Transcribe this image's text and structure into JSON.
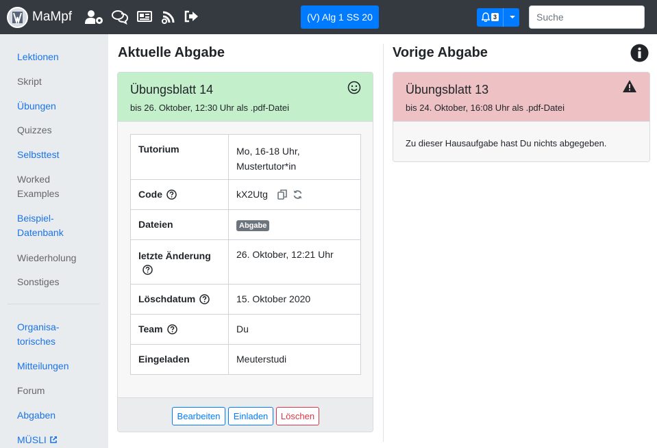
{
  "app": {
    "brand": "MaMpf",
    "lecture_button": "(V) Alg 1 SS 20",
    "notification_count": "3",
    "search_placeholder": "Suche",
    "nav_icons": [
      "user-cog-icon",
      "comments-icon",
      "newspaper-icon",
      "blog-icon",
      "sign-out-icon"
    ]
  },
  "sidebar": {
    "items": [
      {
        "label": "Lektionen",
        "link": true
      },
      {
        "label": "Skript",
        "link": false
      },
      {
        "label": "Übungen",
        "link": true
      },
      {
        "label": "Quizzes",
        "link": false
      },
      {
        "label": "Selbsttest",
        "link": true
      },
      {
        "label": "Worked Examples",
        "link": false
      },
      {
        "label": "Beispiel-Datenbank",
        "link": true
      },
      {
        "label": "Wiederholung",
        "link": false
      },
      {
        "label": "Sonstiges",
        "link": false
      }
    ],
    "items2": [
      {
        "label": "Organisa-torisches",
        "link": true
      },
      {
        "label": "Mitteilungen",
        "link": true
      },
      {
        "label": "Forum",
        "link": false
      },
      {
        "label": "Abgaben",
        "link": true
      },
      {
        "label": "MÜSLI",
        "link": true
      }
    ]
  },
  "current": {
    "heading": "Aktuelle Abgabe",
    "title": "Übungsblatt 14",
    "subtitle": "bis 26. Oktober, 12:30 Uhr als .pdf-Datei",
    "rows": {
      "tutorium_label": "Tutorium",
      "tutorium_value": "Mo, 16-18 Uhr, Mustertutor*in",
      "code_label": "Code",
      "code_value": "kX2Utg",
      "dateien_label": "Dateien",
      "dateien_badge": "Abgabe",
      "aenderung_label": "letzte Änderung",
      "aenderung_value": "26. Oktober, 12:21 Uhr",
      "loesch_label": "Löschdatum",
      "loesch_value": "15. Oktober 2020",
      "team_label": "Team",
      "team_value": "Du",
      "eingeladen_label": "Eingeladen",
      "eingeladen_value": "Meuterstudi"
    },
    "buttons": {
      "edit": "Bearbeiten",
      "invite": "Einladen",
      "delete": "Löschen"
    },
    "colors": {
      "header": "#c3efca"
    }
  },
  "previous": {
    "heading": "Vorige Abgabe",
    "title": "Übungsblatt 13",
    "subtitle": "bis 24. Oktober, 16:08 Uhr als .pdf-Datei",
    "message": "Zu dieser Hausaufgabe hast Du nichts abgegeben.",
    "colors": {
      "header": "#eec2c4"
    }
  },
  "colors": {
    "navbar": "#343a40",
    "primary": "#007bff",
    "danger": "#dc3545",
    "sidebar": "#e9ecef"
  }
}
